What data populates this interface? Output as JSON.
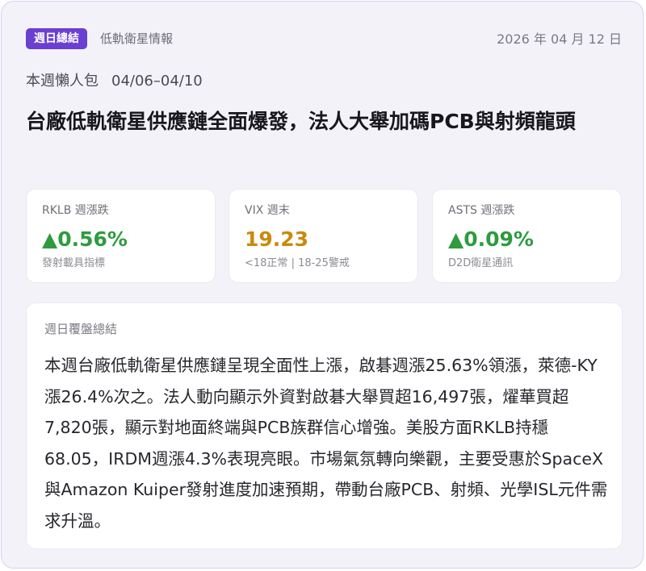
{
  "header": {
    "badge": "週日總結",
    "source": "低軌衛星情報",
    "date": "2026 年 04 月 12 日"
  },
  "week": {
    "label": "本週懶人包",
    "range": "04/06–04/10"
  },
  "headline": "台廠低軌衛星供應鏈全面爆發，法人大舉加碼PCB與射頻龍頭",
  "stats": [
    {
      "label": "RKLB 週漲跌",
      "value": "▲0.56%",
      "note": "發射載具指標",
      "color": "#2e9b3e"
    },
    {
      "label": "VIX 週末",
      "value": "19.23",
      "note": "<18正常 | 18-25警戒",
      "color": "#c98a0c"
    },
    {
      "label": "ASTS 週漲跌",
      "value": "▲0.09%",
      "note": "D2D衛星通訊",
      "color": "#2e9b3e"
    }
  ],
  "summary": {
    "title": "週日覆盤總結",
    "body": "本週台廠低軌衛星供應鏈呈現全面性上漲，啟碁週漲25.63%領漲，萊德-KY漲26.4%次之。法人動向顯示外資對啟碁大舉買超16,497張，燿華買超7,820張，顯示對地面終端與PCB族群信心增強。美股方面RKLB持穩68.05，IRDM週漲4.3%表現亮眼。市場氣氛轉向樂觀，主要受惠於SpaceX與Amazon Kuiper發射進度加速預期，帶動台廠PCB、射頻、光學ISL元件需求升溫。"
  }
}
